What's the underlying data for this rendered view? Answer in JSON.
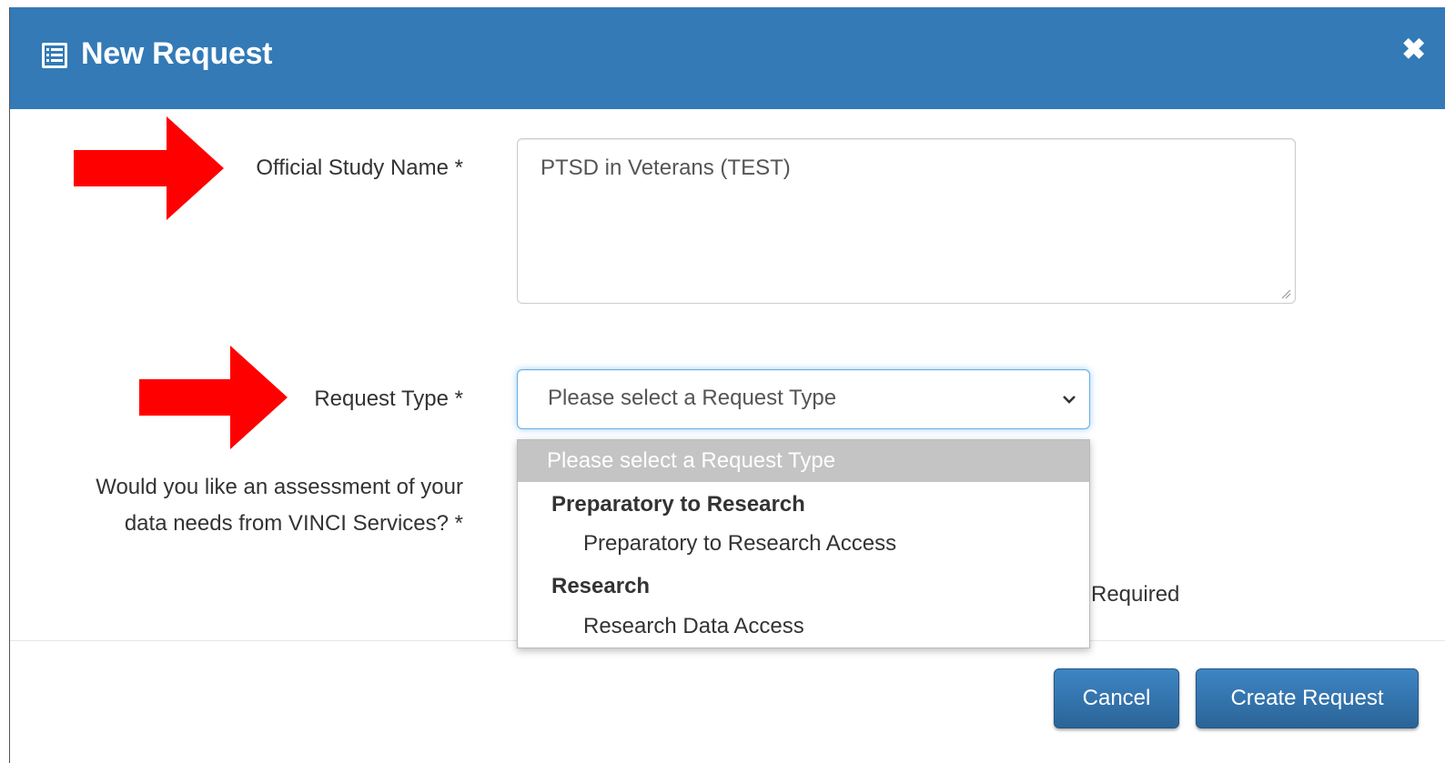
{
  "modal": {
    "title": "New Request",
    "title_icon": "list-alt-icon",
    "close_label": "✖"
  },
  "form": {
    "study_name_label": "Official Study Name *",
    "study_name_value": "PTSD in Veterans (TEST)",
    "request_type_label": "Request Type *",
    "request_type_selected": "Please select a Request Type",
    "assessment_label_line1": "Would you like an assessment of your",
    "assessment_label_line2": "data needs from VINCI Services? *",
    "required_partial_text": "Required"
  },
  "dropdown": {
    "placeholder": "Please select a Request Type",
    "groups": [
      {
        "label": "Preparatory to Research",
        "options": [
          "Preparatory to Research Access"
        ]
      },
      {
        "label": "Research",
        "options": [
          "Research Data Access"
        ]
      }
    ]
  },
  "footer": {
    "cancel_label": "Cancel",
    "create_label": "Create Request"
  },
  "annotations": {
    "arrow_color": "#ff0000",
    "arrow_icons": [
      "right-arrow-icon",
      "right-arrow-icon"
    ]
  },
  "colors": {
    "header_bg": "#337ab7",
    "button_bg": "#337ab7"
  }
}
